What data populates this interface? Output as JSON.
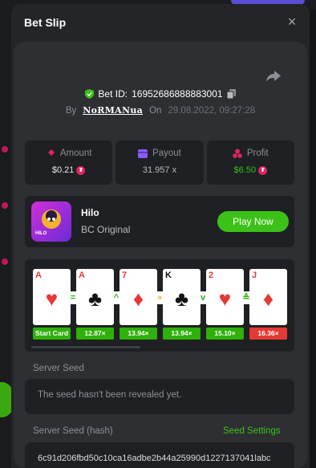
{
  "modal": {
    "title": "Bet Slip",
    "close": "×"
  },
  "bet": {
    "id_label": "Bet ID:",
    "id": "16952686888883001",
    "by_label": "By",
    "user": "NoRMANua",
    "on_label": "On",
    "date": "29.08.2022, 09:27:28"
  },
  "stats": {
    "amount_label": "Amount",
    "amount": "$0.21",
    "payout_label": "Payout",
    "payout": "31.957 x",
    "profit_label": "Profit",
    "profit": "$6.50"
  },
  "game": {
    "name": "Hilo",
    "provider": "BC Original",
    "icon_text": "HILO",
    "play_label": "Play Now"
  },
  "cards": [
    {
      "rank": "A",
      "suit": "♥",
      "color": "red",
      "mult": "Start Card"
    },
    {
      "rank": "A",
      "suit": "♣",
      "color": "blk",
      "mult": "12.87×"
    },
    {
      "rank": "7",
      "suit": "♦",
      "color": "red",
      "mult": "13.94×"
    },
    {
      "rank": "K",
      "suit": "♣",
      "color": "blk",
      "mult": "13.94×"
    },
    {
      "rank": "2",
      "suit": "♥",
      "color": "red",
      "mult": "15.10×"
    },
    {
      "rank": "J",
      "suit": "♦",
      "color": "red",
      "mult": "16.36×"
    }
  ],
  "arrows": [
    "=",
    "^",
    "»",
    "v",
    "≙"
  ],
  "seed": {
    "server_label": "Server Seed",
    "server_value": "The seed hasn't been revealed yet.",
    "hash_label": "Server Seed (hash)",
    "settings_link": "Seed Settings",
    "hash_value": "6c91d206fbd50c10ca16adbe2b44a25990d1227137041labc"
  },
  "colors": {
    "accent_green": "#3bc117",
    "coin_red": "#e0245e",
    "payout_purple": "#8b5cf6"
  }
}
